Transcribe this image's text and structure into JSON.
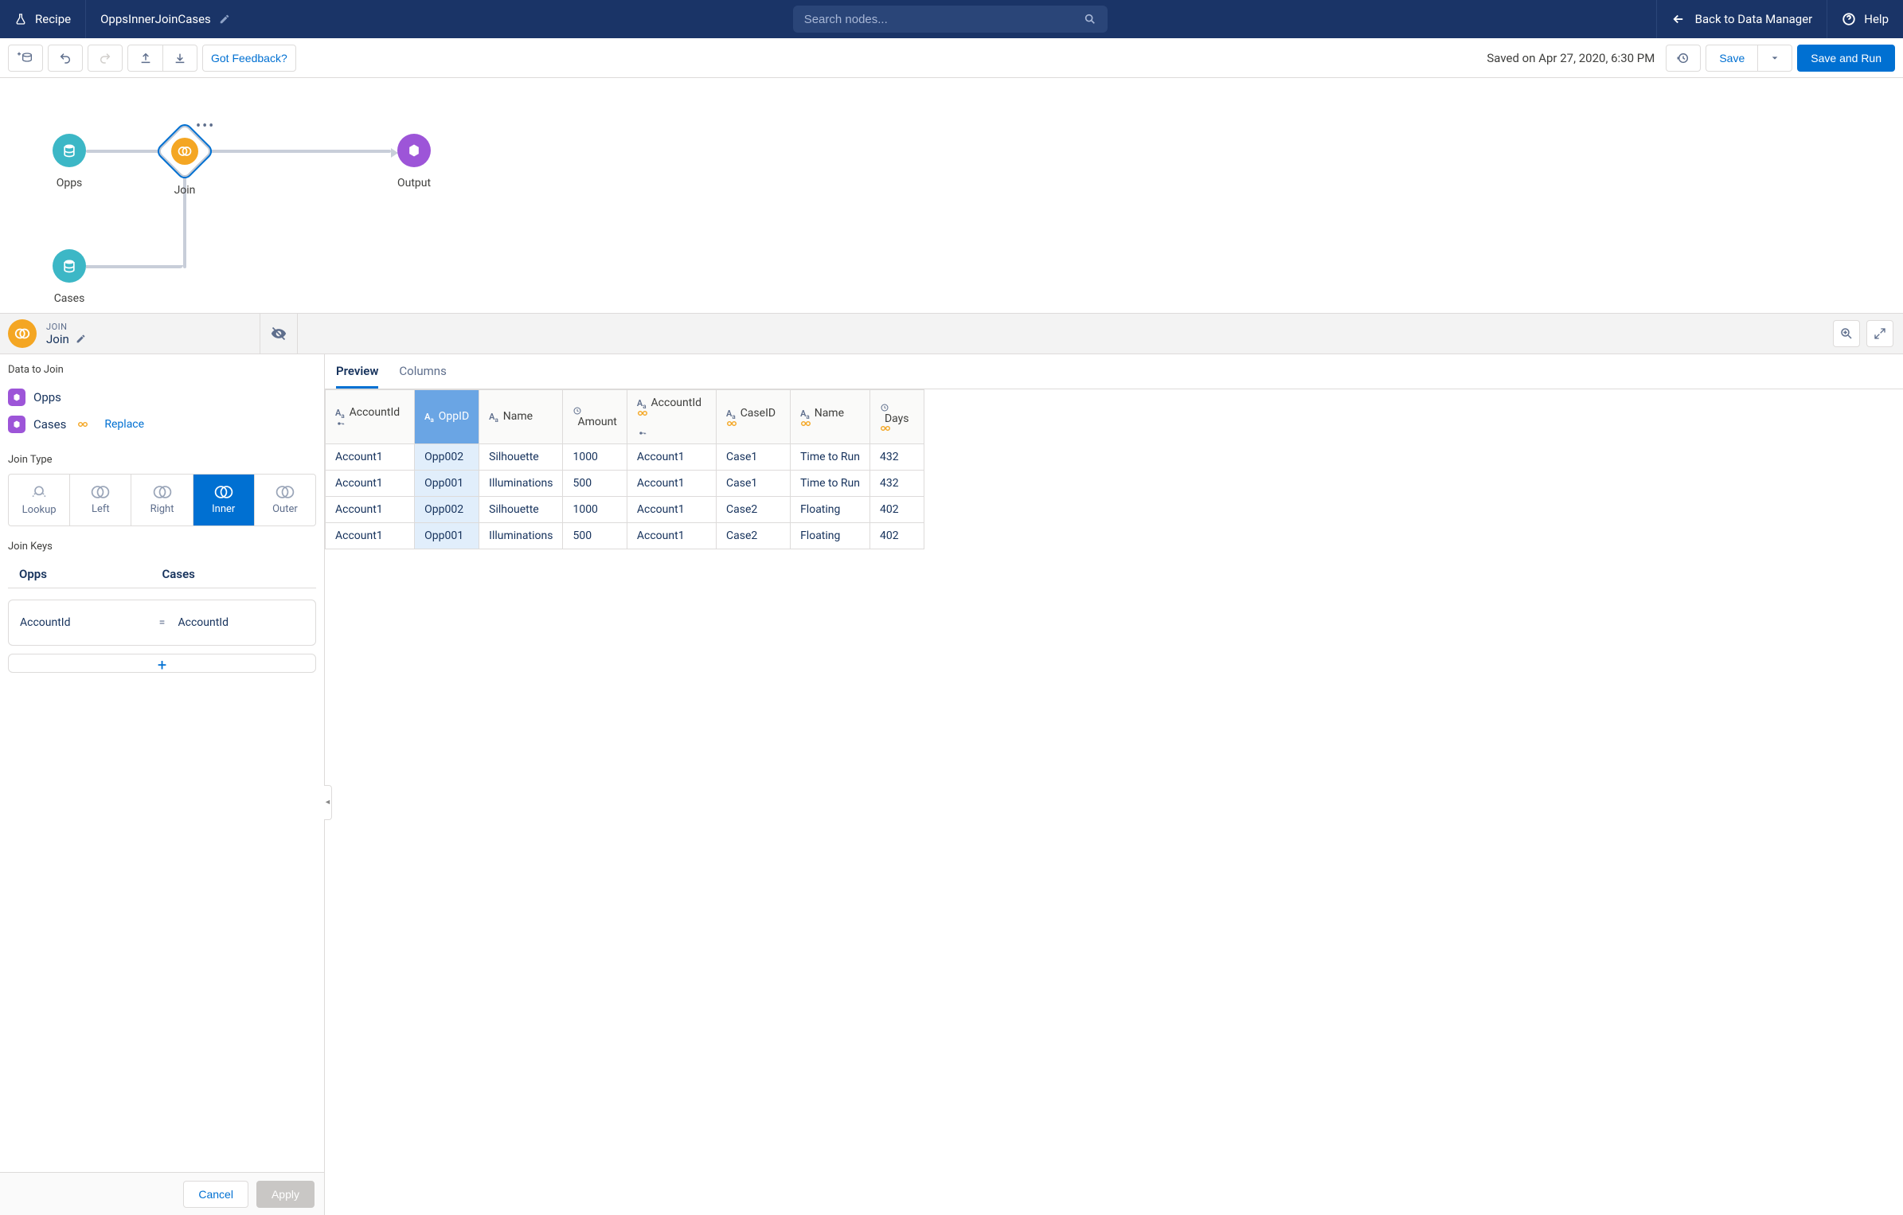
{
  "header": {
    "recipe": "Recipe",
    "title": "OppsInnerJoinCases",
    "search_placeholder": "Search nodes...",
    "back": "Back to Data Manager",
    "help": "Help"
  },
  "toolbar": {
    "feedback": "Got Feedback?",
    "saved_text": "Saved on Apr 27, 2020, 6:30 PM",
    "save": "Save",
    "save_run": "Save and Run"
  },
  "canvas": {
    "opps": "Opps",
    "cases": "Cases",
    "join": "Join",
    "output": "Output"
  },
  "join_header": {
    "subtype": "JOIN",
    "title": "Join"
  },
  "left_panel": {
    "data_to_join": "Data to Join",
    "opps": "Opps",
    "cases": "Cases",
    "replace": "Replace",
    "join_type_label": "Join Type",
    "join_types": {
      "lookup": "Lookup",
      "left": "Left",
      "right": "Right",
      "inner": "Inner",
      "outer": "Outer"
    },
    "join_keys_label": "Join Keys",
    "jk_sources": {
      "a": "Opps",
      "b": "Cases"
    },
    "jk_row": {
      "a": "AccountId",
      "b": "AccountId"
    },
    "cancel": "Cancel",
    "apply": "Apply"
  },
  "tabs": {
    "preview": "Preview",
    "columns": "Columns"
  },
  "grid": {
    "columns": [
      {
        "label": "AccountId",
        "type": "Aa",
        "key": true,
        "link": false
      },
      {
        "label": "OppID",
        "type": "Aa",
        "key": false,
        "link": false,
        "selected": true
      },
      {
        "label": "Name",
        "type": "Aa",
        "key": false,
        "link": false
      },
      {
        "label": "Amount",
        "type": "num",
        "key": false,
        "link": false
      },
      {
        "label": "AccountId",
        "type": "Aa",
        "key": true,
        "link": true
      },
      {
        "label": "CaseID",
        "type": "Aa",
        "key": false,
        "link": true
      },
      {
        "label": "Name",
        "type": "Aa",
        "key": false,
        "link": true
      },
      {
        "label": "Days",
        "type": "num",
        "key": false,
        "link": true
      }
    ],
    "rows": [
      [
        "Account1",
        "Opp002",
        "Silhouette",
        "1000",
        "Account1",
        "Case1",
        "Time to Run",
        "432"
      ],
      [
        "Account1",
        "Opp001",
        "Illuminations",
        "500",
        "Account1",
        "Case1",
        "Time to Run",
        "432"
      ],
      [
        "Account1",
        "Opp002",
        "Silhouette",
        "1000",
        "Account1",
        "Case2",
        "Floating",
        "402"
      ],
      [
        "Account1",
        "Opp001",
        "Illuminations",
        "500",
        "Account1",
        "Case2",
        "Floating",
        "402"
      ]
    ]
  }
}
